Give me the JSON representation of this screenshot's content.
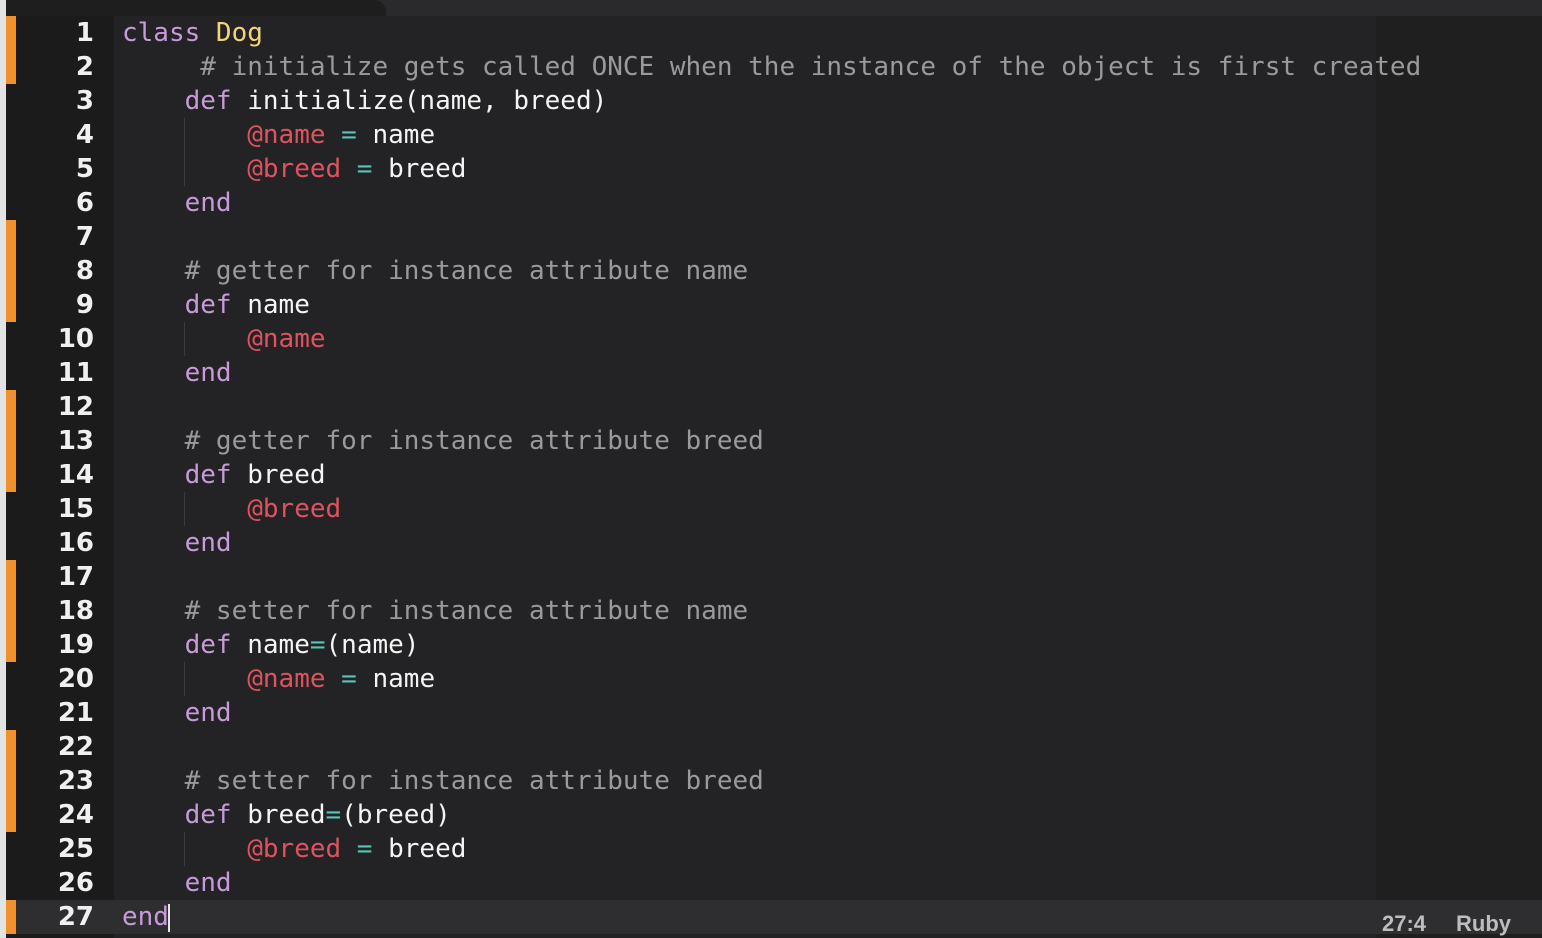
{
  "status": {
    "cursor_position": "27:4",
    "language": "Ruby"
  },
  "colors": {
    "background": "#232325",
    "keyword": "#c79ad9",
    "class_name": "#f2d47a",
    "instance_variable": "#e0525e",
    "operator": "#58c4b5",
    "comment": "#9a9a9a",
    "change_marker": "#f0912b"
  },
  "lines": [
    {
      "num": "1",
      "changed": true,
      "tokens": [
        {
          "t": "class ",
          "c": "kw"
        },
        {
          "t": "Dog",
          "c": "cls"
        }
      ]
    },
    {
      "num": "2",
      "changed": true,
      "tokens": [
        {
          "t": "     # initialize gets called ONCE when the instance of the object is first created",
          "c": "cmt"
        }
      ]
    },
    {
      "num": "3",
      "changed": false,
      "tokens": [
        {
          "t": "    def ",
          "c": "kw"
        },
        {
          "t": "initialize(name, breed)",
          "c": "plain"
        }
      ]
    },
    {
      "num": "4",
      "changed": false,
      "tokens": [
        {
          "t": "        ",
          "c": "plain"
        },
        {
          "t": "@name",
          "c": "ivar"
        },
        {
          "t": " = ",
          "c": "op"
        },
        {
          "t": "name",
          "c": "plain"
        }
      ]
    },
    {
      "num": "5",
      "changed": false,
      "tokens": [
        {
          "t": "        ",
          "c": "plain"
        },
        {
          "t": "@breed",
          "c": "ivar"
        },
        {
          "t": " = ",
          "c": "op"
        },
        {
          "t": "breed",
          "c": "plain"
        }
      ]
    },
    {
      "num": "6",
      "changed": false,
      "tokens": [
        {
          "t": "    end",
          "c": "kw"
        }
      ]
    },
    {
      "num": "7",
      "changed": true,
      "tokens": []
    },
    {
      "num": "8",
      "changed": true,
      "tokens": [
        {
          "t": "    # getter for instance attribute name",
          "c": "cmt"
        }
      ]
    },
    {
      "num": "9",
      "changed": true,
      "tokens": [
        {
          "t": "    def ",
          "c": "kw"
        },
        {
          "t": "name",
          "c": "plain"
        }
      ]
    },
    {
      "num": "10",
      "changed": false,
      "tokens": [
        {
          "t": "        ",
          "c": "plain"
        },
        {
          "t": "@name",
          "c": "ivar"
        }
      ]
    },
    {
      "num": "11",
      "changed": false,
      "tokens": [
        {
          "t": "    end",
          "c": "kw"
        }
      ]
    },
    {
      "num": "12",
      "changed": true,
      "tokens": []
    },
    {
      "num": "13",
      "changed": true,
      "tokens": [
        {
          "t": "    # getter for instance attribute breed",
          "c": "cmt"
        }
      ]
    },
    {
      "num": "14",
      "changed": true,
      "tokens": [
        {
          "t": "    def ",
          "c": "kw"
        },
        {
          "t": "breed",
          "c": "plain"
        }
      ]
    },
    {
      "num": "15",
      "changed": false,
      "tokens": [
        {
          "t": "        ",
          "c": "plain"
        },
        {
          "t": "@breed",
          "c": "ivar"
        }
      ]
    },
    {
      "num": "16",
      "changed": false,
      "tokens": [
        {
          "t": "    end",
          "c": "kw"
        }
      ]
    },
    {
      "num": "17",
      "changed": true,
      "tokens": []
    },
    {
      "num": "18",
      "changed": true,
      "tokens": [
        {
          "t": "    # setter for instance attribute name",
          "c": "cmt"
        }
      ]
    },
    {
      "num": "19",
      "changed": true,
      "tokens": [
        {
          "t": "    def ",
          "c": "kw"
        },
        {
          "t": "name",
          "c": "plain"
        },
        {
          "t": "=",
          "c": "op"
        },
        {
          "t": "(name)",
          "c": "plain"
        }
      ]
    },
    {
      "num": "20",
      "changed": false,
      "tokens": [
        {
          "t": "        ",
          "c": "plain"
        },
        {
          "t": "@name",
          "c": "ivar"
        },
        {
          "t": " = ",
          "c": "op"
        },
        {
          "t": "name",
          "c": "plain"
        }
      ]
    },
    {
      "num": "21",
      "changed": false,
      "tokens": [
        {
          "t": "    end",
          "c": "kw"
        }
      ]
    },
    {
      "num": "22",
      "changed": true,
      "tokens": []
    },
    {
      "num": "23",
      "changed": true,
      "tokens": [
        {
          "t": "    # setter for instance attribute breed",
          "c": "cmt"
        }
      ]
    },
    {
      "num": "24",
      "changed": true,
      "tokens": [
        {
          "t": "    def ",
          "c": "kw"
        },
        {
          "t": "breed",
          "c": "plain"
        },
        {
          "t": "=",
          "c": "op"
        },
        {
          "t": "(breed)",
          "c": "plain"
        }
      ]
    },
    {
      "num": "25",
      "changed": false,
      "tokens": [
        {
          "t": "        ",
          "c": "plain"
        },
        {
          "t": "@breed",
          "c": "ivar"
        },
        {
          "t": " = ",
          "c": "op"
        },
        {
          "t": "breed",
          "c": "plain"
        }
      ]
    },
    {
      "num": "26",
      "changed": false,
      "tokens": [
        {
          "t": "    end",
          "c": "kw"
        }
      ]
    },
    {
      "num": "27",
      "changed": true,
      "active": true,
      "tokens": [
        {
          "t": "end",
          "c": "kw"
        }
      ]
    }
  ]
}
